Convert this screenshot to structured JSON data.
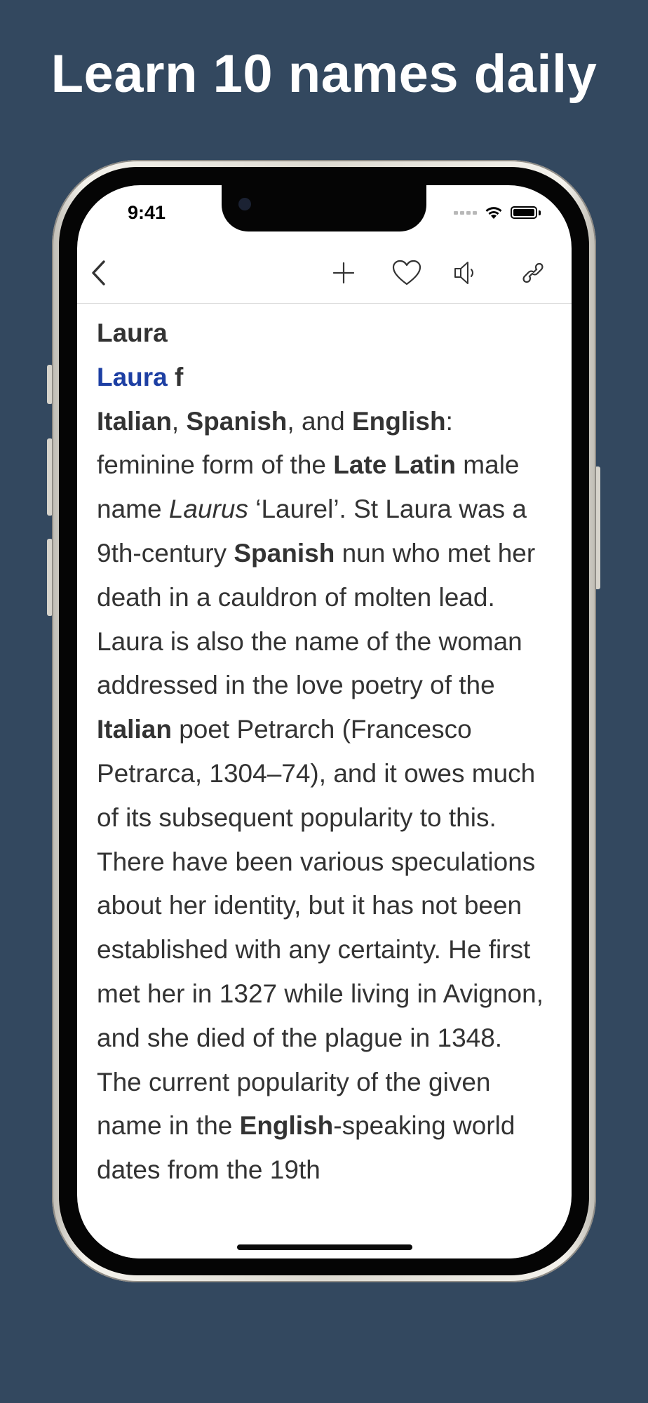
{
  "banner": {
    "headline": "Learn 10 names daily"
  },
  "status_bar": {
    "time": "9:41"
  },
  "toolbar": {
    "back_icon": "chevron-left-icon",
    "add_icon": "plus-icon",
    "favorite_icon": "heart-icon",
    "audio_icon": "speaker-icon",
    "link_icon": "link-icon"
  },
  "entry": {
    "title": "Laura",
    "name_link": "Laura",
    "gender": "f",
    "origin_1": "Italian",
    "sep_1": ", ",
    "origin_2": "Spanish",
    "sep_2": ", and ",
    "origin_3": "English",
    "sep_3": ":",
    "t1": " feminine form of the ",
    "b1": "Late Latin",
    "t2": " male name ",
    "i1": "Laurus",
    "t3": " ‘Laurel’. St Laura was a 9th-century ",
    "b2": "Spanish",
    "t4": " nun who met her death in a cauldron of molten lead. Laura is also the name of the woman addressed in the love poetry of the ",
    "b3": "Italian",
    "t5": " poet Petrarch (Francesco Petrarca, 1304–74), and it owes much of its subsequent popularity to this. There have been various speculations about her identity, but it has not been established with any certainty. He first met her in 1327 while living in Avignon, and she died of the plague in 1348. The current popularity of the given name in the ",
    "b4": "English",
    "t6": "-speaking world dates from the 19th"
  },
  "colors": {
    "background": "#33485f",
    "link": "#1d3fa3",
    "text": "#333333"
  }
}
